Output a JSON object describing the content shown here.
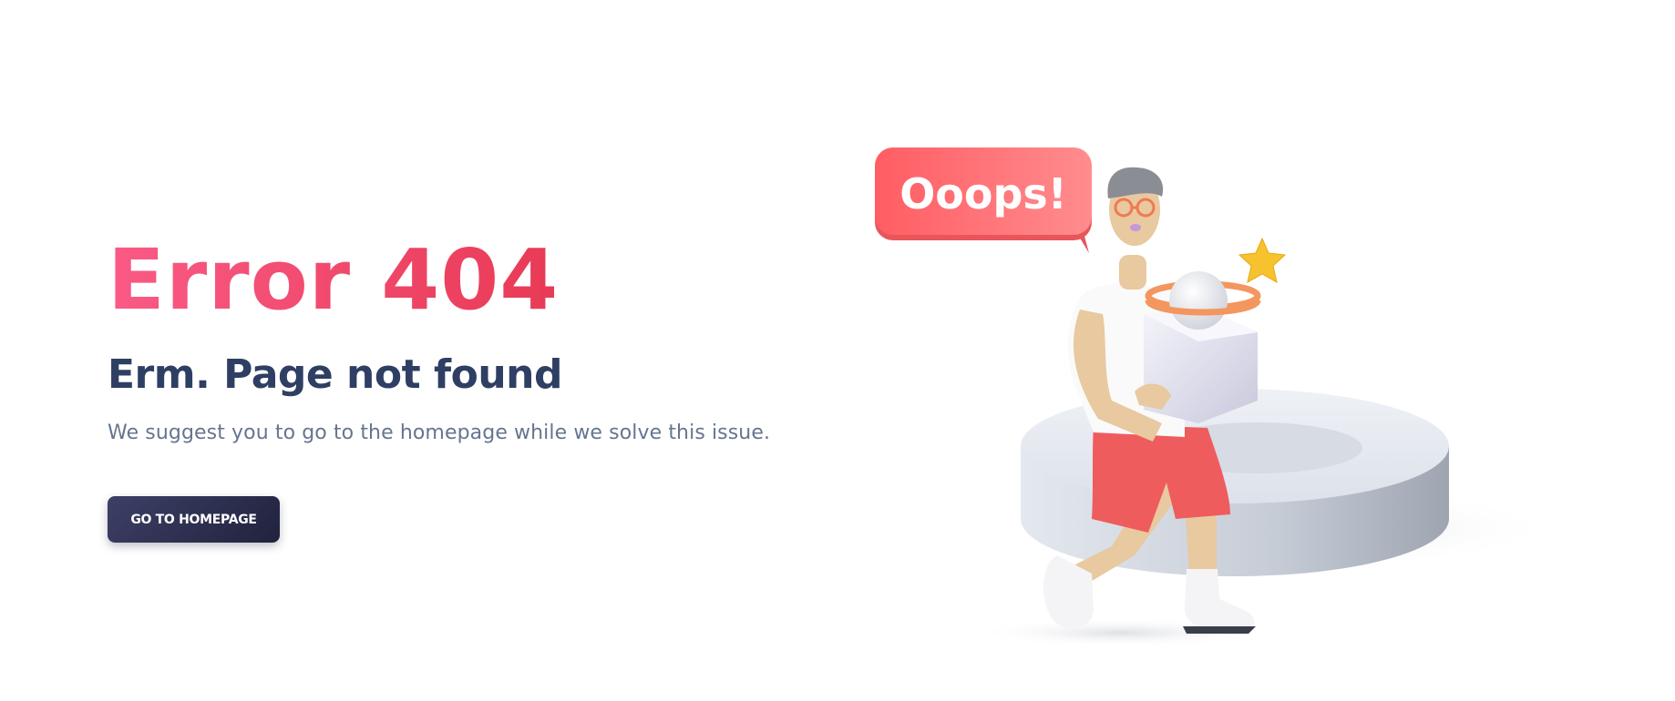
{
  "hero": {
    "title": "Error 404",
    "subtitle": "Erm. Page not found",
    "description": "We suggest you to go to the homepage while we solve this issue.",
    "button_label": "GO TO HOMEPAGE"
  },
  "illustration": {
    "speech_bubble_text": "Ooops!"
  },
  "colors": {
    "title_gradient_start": "#fa5a86",
    "title_gradient_end": "#e83a55",
    "subtitle": "#2e3f63",
    "description": "#66758f",
    "button": "#2a2c4a",
    "bubble": "#ff6f73"
  }
}
